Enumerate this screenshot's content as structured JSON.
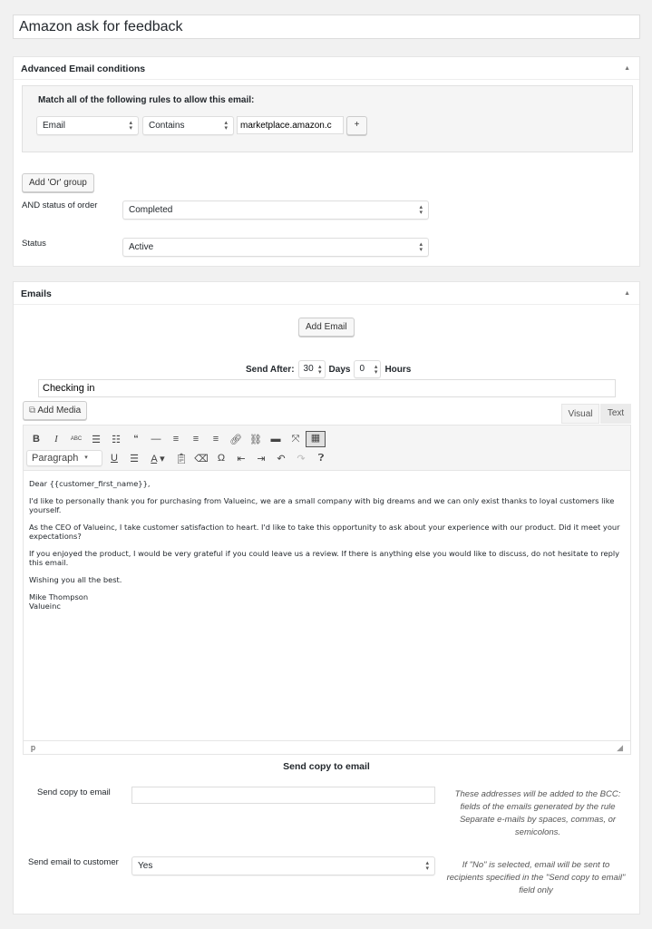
{
  "title": "Amazon ask for feedback",
  "conditions": {
    "header": "Advanced Email conditions",
    "match_text": "Match all of the following rules to allow this email:",
    "field": "Email",
    "operator": "Contains",
    "value": "marketplace.amazon.c",
    "plus": "+",
    "add_or": "Add 'Or' group",
    "order_status_label": "AND status of order",
    "order_status": "Completed",
    "status_label": "Status",
    "status": "Active"
  },
  "emails": {
    "header": "Emails",
    "add_email": "Add Email",
    "send_after_label": "Send After:",
    "days": "30",
    "days_label": "Days",
    "hours": "0",
    "hours_label": "Hours",
    "subject": "Checking in",
    "add_media": "Add Media",
    "tab_visual": "Visual",
    "tab_text": "Text",
    "format": "Paragraph",
    "toolbar_row1": [
      "bold-icon",
      "italic-icon",
      "strikethrough-icon",
      "bullet-list-icon",
      "numbered-list-icon",
      "blockquote-icon",
      "horizontal-line-icon",
      "align-left-icon",
      "align-center-icon",
      "align-right-icon",
      "link-icon",
      "unlink-icon",
      "read-more-icon",
      "fullscreen-icon",
      "toolbar-toggle-icon"
    ],
    "toolbar_row2": [
      "underline-icon",
      "justify-icon",
      "text-color-icon",
      "paste-text-icon",
      "clear-formatting-icon",
      "special-character-icon",
      "outdent-icon",
      "indent-icon",
      "undo-icon",
      "redo-icon",
      "help-icon"
    ],
    "body": [
      "Dear {{customer_first_name}},",
      "I'd like to personally thank you for purchasing from Valueinc, we are a small company with big dreams and we can only exist thanks to loyal customers like yourself.",
      "As the CEO of Valueinc, I take customer satisfaction to heart. I'd like to take this opportunity to ask about your experience with our product. Did it meet your expectations?",
      "If you enjoyed the product, I would be very grateful if you could leave us a review. If there is anything else you would like to discuss, do not hesitate to reply this email.",
      "Wishing you all the best."
    ],
    "signature_name": "Mike Thompson",
    "signature_company": "Valueinc",
    "path": "p",
    "copy_heading": "Send copy to email",
    "copy_label": "Send copy to email",
    "copy_value": "",
    "copy_help": "These addresses will be added to the BCC: fields of the emails generated by the rule Separate e-mails by spaces, commas, or semicolons.",
    "customer_label": "Send email to customer",
    "customer_value": "Yes",
    "customer_help": "If \"No\" is selected, email will be sent to recipients specified in the \"Send copy to email\" field only"
  }
}
